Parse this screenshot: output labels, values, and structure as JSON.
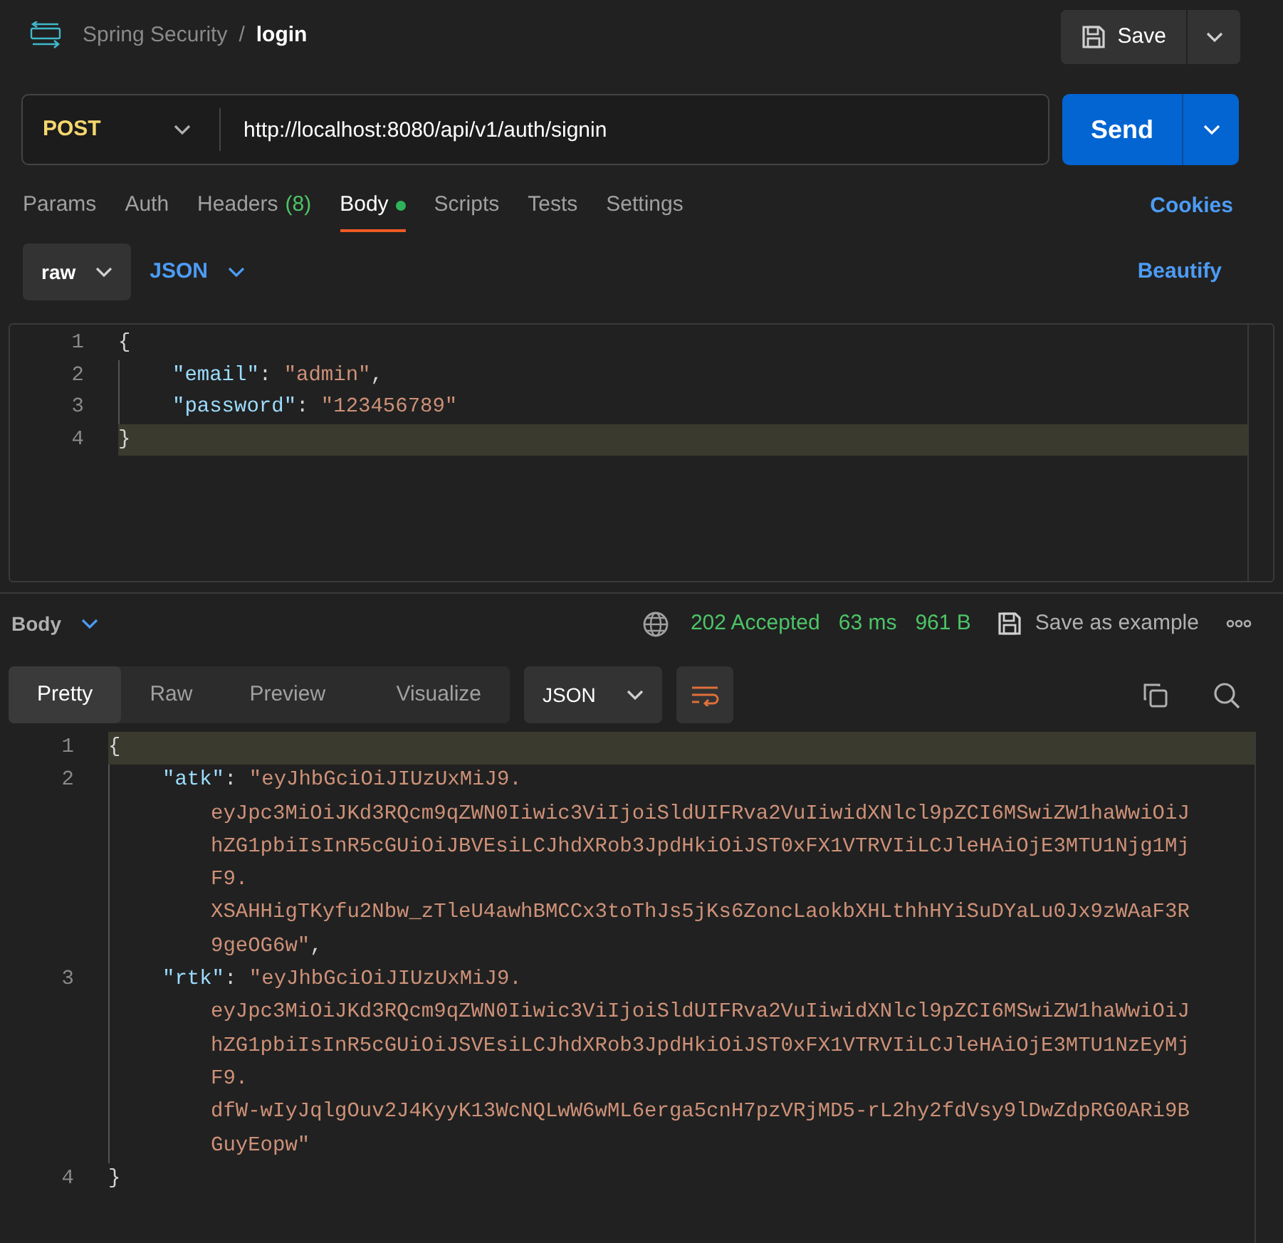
{
  "header": {
    "collection": "Spring Security",
    "separator": "/",
    "request": "login",
    "save": "Save"
  },
  "request": {
    "method": "POST",
    "url": "http://localhost:8080/api/v1/auth/signin",
    "send": "Send"
  },
  "tabs": [
    {
      "label": "Params",
      "selected": false
    },
    {
      "label": "Auth",
      "selected": false
    },
    {
      "label": "Headers",
      "count": "(8)",
      "selected": false
    },
    {
      "label": "Body",
      "has_content": true,
      "selected": true
    },
    {
      "label": "Scripts",
      "selected": false
    },
    {
      "label": "Tests",
      "selected": false
    },
    {
      "label": "Settings",
      "selected": false
    }
  ],
  "cookies": "Cookies",
  "body_type": {
    "mode": "raw",
    "language": "JSON",
    "beautify": "Beautify"
  },
  "request_body": {
    "lines": [
      {
        "number": "1",
        "current": false,
        "indent": false,
        "tokens": [
          {
            "kind": "punct",
            "text": "{"
          }
        ]
      },
      {
        "number": "2",
        "current": false,
        "indent": true,
        "tokens": [
          {
            "kind": "key",
            "text": "\"email\""
          },
          {
            "kind": "punct",
            "text": ": "
          },
          {
            "kind": "string",
            "text": "\"admin\""
          },
          {
            "kind": "punct",
            "text": ","
          }
        ]
      },
      {
        "number": "3",
        "current": false,
        "indent": true,
        "tokens": [
          {
            "kind": "key",
            "text": "\"password\""
          },
          {
            "kind": "punct",
            "text": ": "
          },
          {
            "kind": "string",
            "text": "\"123456789\""
          }
        ]
      },
      {
        "number": "4",
        "current": true,
        "indent": false,
        "tokens": [
          {
            "kind": "punct",
            "text": "}"
          }
        ]
      }
    ]
  },
  "response": {
    "view": "Body",
    "status": "202 Accepted",
    "time": "63 ms",
    "size": "961 B",
    "save_example": "Save as example",
    "tabs": [
      {
        "label": "Pretty",
        "selected": true
      },
      {
        "label": "Raw",
        "selected": false
      },
      {
        "label": "Preview",
        "selected": false
      },
      {
        "label": "Visualize",
        "selected": false
      }
    ],
    "format": "JSON",
    "word_wrap": true,
    "lines": [
      {
        "number": "1",
        "current": true,
        "indent": false,
        "tokens": [
          {
            "kind": "punct",
            "text": "{"
          }
        ]
      },
      {
        "number": "2",
        "current": false,
        "indent": true,
        "tokens": [
          {
            "kind": "key",
            "text": "\"atk\""
          },
          {
            "kind": "punct",
            "text": ": "
          },
          {
            "kind": "string",
            "text": "\"eyJhbGciOiJIUzUxMiJ9."
          }
        ],
        "wrapped": [
          [
            {
              "kind": "string",
              "text": "eyJpc3MiOiJKd3RQcm9qZWN0Iiwic3ViIjoiSldUIFRva2VuIiwidXNlcl9pZCI6MSwiZW1haWwiOiJ"
            }
          ],
          [
            {
              "kind": "string",
              "text": "hZG1pbiIsInR5cGUiOiJBVEsiLCJhdXRob3JpdHkiOiJST0xFX1VTRVIiLCJleHAiOjE3MTU1Njg1Mj"
            }
          ],
          [
            {
              "kind": "string",
              "text": "F9."
            }
          ],
          [
            {
              "kind": "string",
              "text": "XSAHHigTKyfu2Nbw_zTleU4awhBMCCx3toThJs5jKs6ZoncLaokbXHLthhHYiSuDYaLu0Jx9zWAaF3R"
            }
          ],
          [
            {
              "kind": "string",
              "text": "9geOG6w\""
            },
            {
              "kind": "punct",
              "text": ","
            }
          ]
        ]
      },
      {
        "number": "3",
        "current": false,
        "indent": true,
        "tokens": [
          {
            "kind": "key",
            "text": "\"rtk\""
          },
          {
            "kind": "punct",
            "text": ": "
          },
          {
            "kind": "string",
            "text": "\"eyJhbGciOiJIUzUxMiJ9."
          }
        ],
        "wrapped": [
          [
            {
              "kind": "string",
              "text": "eyJpc3MiOiJKd3RQcm9qZWN0Iiwic3ViIjoiSldUIFRva2VuIiwidXNlcl9pZCI6MSwiZW1haWwiOiJ"
            }
          ],
          [
            {
              "kind": "string",
              "text": "hZG1pbiIsInR5cGUiOiJSVEsiLCJhdXRob3JpdHkiOiJST0xFX1VTRVIiLCJleHAiOjE3MTU1NzEyMj"
            }
          ],
          [
            {
              "kind": "string",
              "text": "F9."
            }
          ],
          [
            {
              "kind": "string",
              "text": "dfW-wIyJqlgOuv2J4KyyK13WcNQLwW6wML6erga5cnH7pzVRjMD5-rL2hy2fdVsy9lDwZdpRG0ARi9B"
            }
          ],
          [
            {
              "kind": "string",
              "text": "GuyEopw\""
            }
          ]
        ]
      },
      {
        "number": "4",
        "current": false,
        "indent": false,
        "tokens": [
          {
            "kind": "punct",
            "text": "}"
          }
        ]
      }
    ]
  }
}
